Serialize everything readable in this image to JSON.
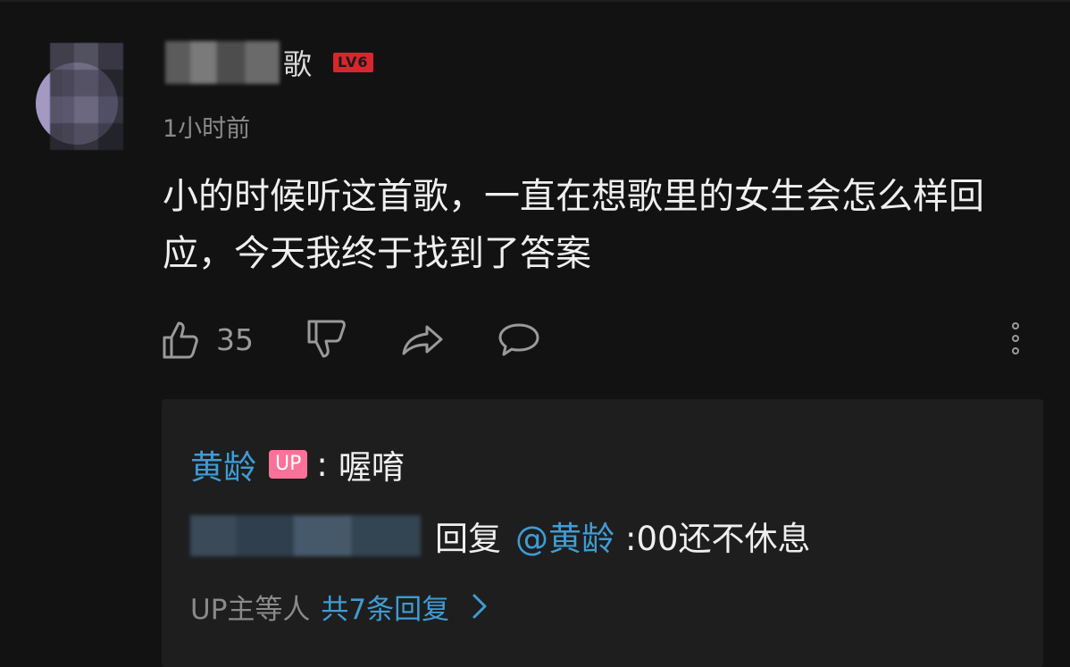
{
  "comment": {
    "username_tail": "歌",
    "level_badge": "LV6",
    "timestamp": "1小时前",
    "text": "小的时候听这首歌，一直在想歌里的女生会怎么样回应，今天我终于找到了答案",
    "like_count": "35",
    "icons": [
      "like-icon",
      "dislike-icon",
      "share-icon",
      "comment-icon",
      "more-icon"
    ]
  },
  "replies": {
    "first": {
      "author": "黄龄",
      "badge": "UP",
      "separator": ":",
      "text": "喔唷"
    },
    "second": {
      "action": "回复",
      "mention": "@黄龄",
      "text": ":00还不休息"
    },
    "summary_prefix": "UP主等人",
    "summary_link": "共7条回复"
  },
  "colors": {
    "background": "#121212",
    "panel": "#1e1e1e",
    "link_blue": "#3f9cd4",
    "level_red": "#d8262d",
    "up_pink": "#fb7299"
  }
}
